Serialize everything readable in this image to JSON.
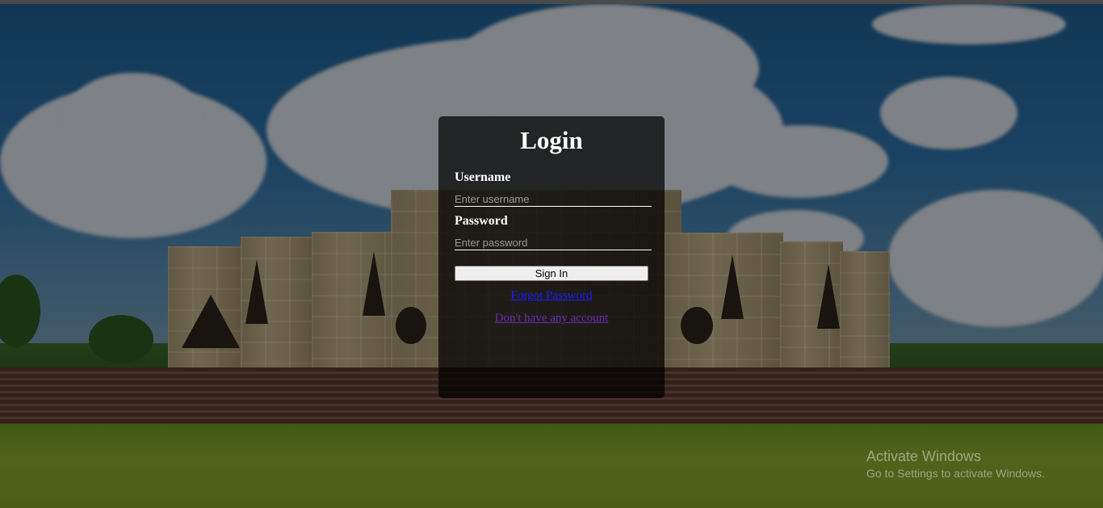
{
  "login": {
    "title": "Login",
    "username_label": "Username",
    "username_placeholder": "Enter username",
    "username_value": "",
    "password_label": "Password",
    "password_placeholder": "Enter password",
    "password_value": "",
    "signin_label": "Sign In",
    "forgot_label": "Forgot Password",
    "register_label": "Don't have any account"
  },
  "watermark": {
    "title": "Activate Windows",
    "subtitle": "Go to Settings to activate Windows."
  },
  "colors": {
    "card_bg": "rgba(0,0,0,0.72)",
    "link_forgot": "#1a1aff",
    "link_visited": "#6a2ab8"
  }
}
